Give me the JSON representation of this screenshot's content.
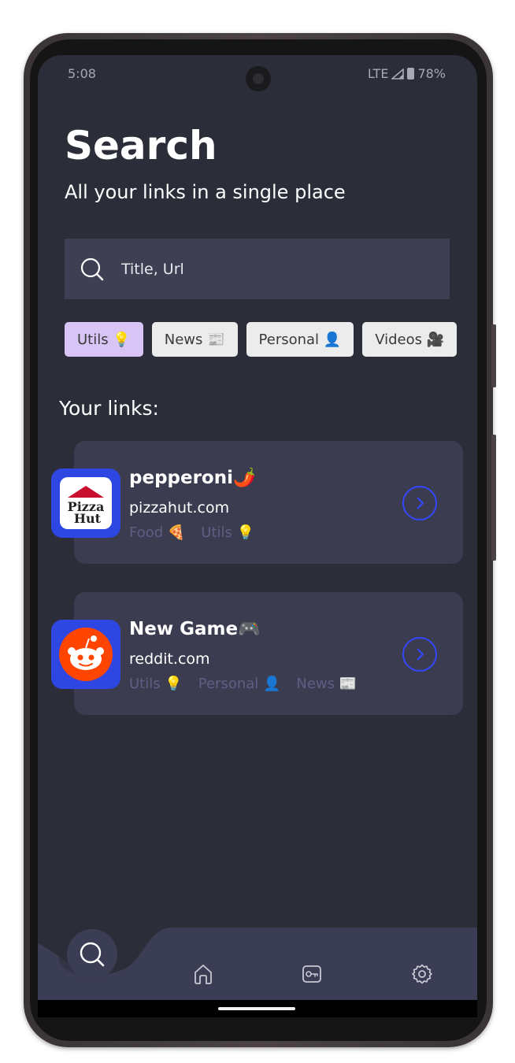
{
  "status": {
    "time": "5:08",
    "network": "LTE",
    "battery": "78%"
  },
  "header": {
    "title": "Search",
    "subtitle": "All your links in a single place"
  },
  "search": {
    "placeholder": "Title, Url"
  },
  "filters": [
    {
      "label": "Utils 💡",
      "active": true
    },
    {
      "label": "News 📰",
      "active": false
    },
    {
      "label": "Personal 👤",
      "active": false
    },
    {
      "label": "Videos 🎥",
      "active": false
    }
  ],
  "links_section": {
    "title": "Your links:"
  },
  "links": [
    {
      "title": "pepperoni🌶️",
      "domain": "pizzahut.com",
      "icon": "pizzahut-logo-icon",
      "tags": [
        "Food 🍕",
        "Utils 💡"
      ]
    },
    {
      "title": "New Game🎮",
      "domain": "reddit.com",
      "icon": "reddit-logo-icon",
      "tags": [
        "Utils 💡",
        "Personal 👤",
        "News 📰"
      ]
    }
  ],
  "logos": {
    "pizzahut_line1": "Pizza",
    "pizzahut_line2": "Hut"
  },
  "nav": [
    "search-icon",
    "home-icon",
    "key-icon",
    "gear-icon"
  ],
  "colors": {
    "background": "#2b2d38",
    "card": "#3c3c50",
    "accent": "#3347ff",
    "chip_active": "#d9c4f6",
    "tag_text": "#5d5f84"
  }
}
